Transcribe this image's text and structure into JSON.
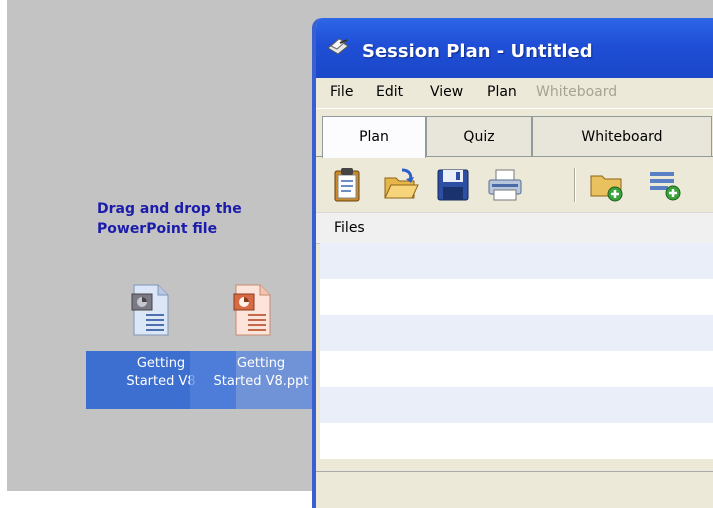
{
  "desktop": {
    "hint": "Drag and drop the PowerPoint file",
    "file_back_label": "Getting\nStarted V8",
    "file_front_label": "Getting\nStarted V8.ppt"
  },
  "window": {
    "title": "Session Plan - Untitled",
    "menu": [
      "File",
      "Edit",
      "View",
      "Plan",
      "Whiteboard"
    ],
    "tabs": [
      "Plan",
      "Quiz",
      "Whiteboard"
    ],
    "active_tab": "Plan",
    "toolbar_icons": [
      "clipboard-icon",
      "open-folder-icon",
      "save-disk-icon",
      "printer-icon",
      "new-folder-icon",
      "add-list-icon"
    ],
    "files_header": "Files"
  }
}
